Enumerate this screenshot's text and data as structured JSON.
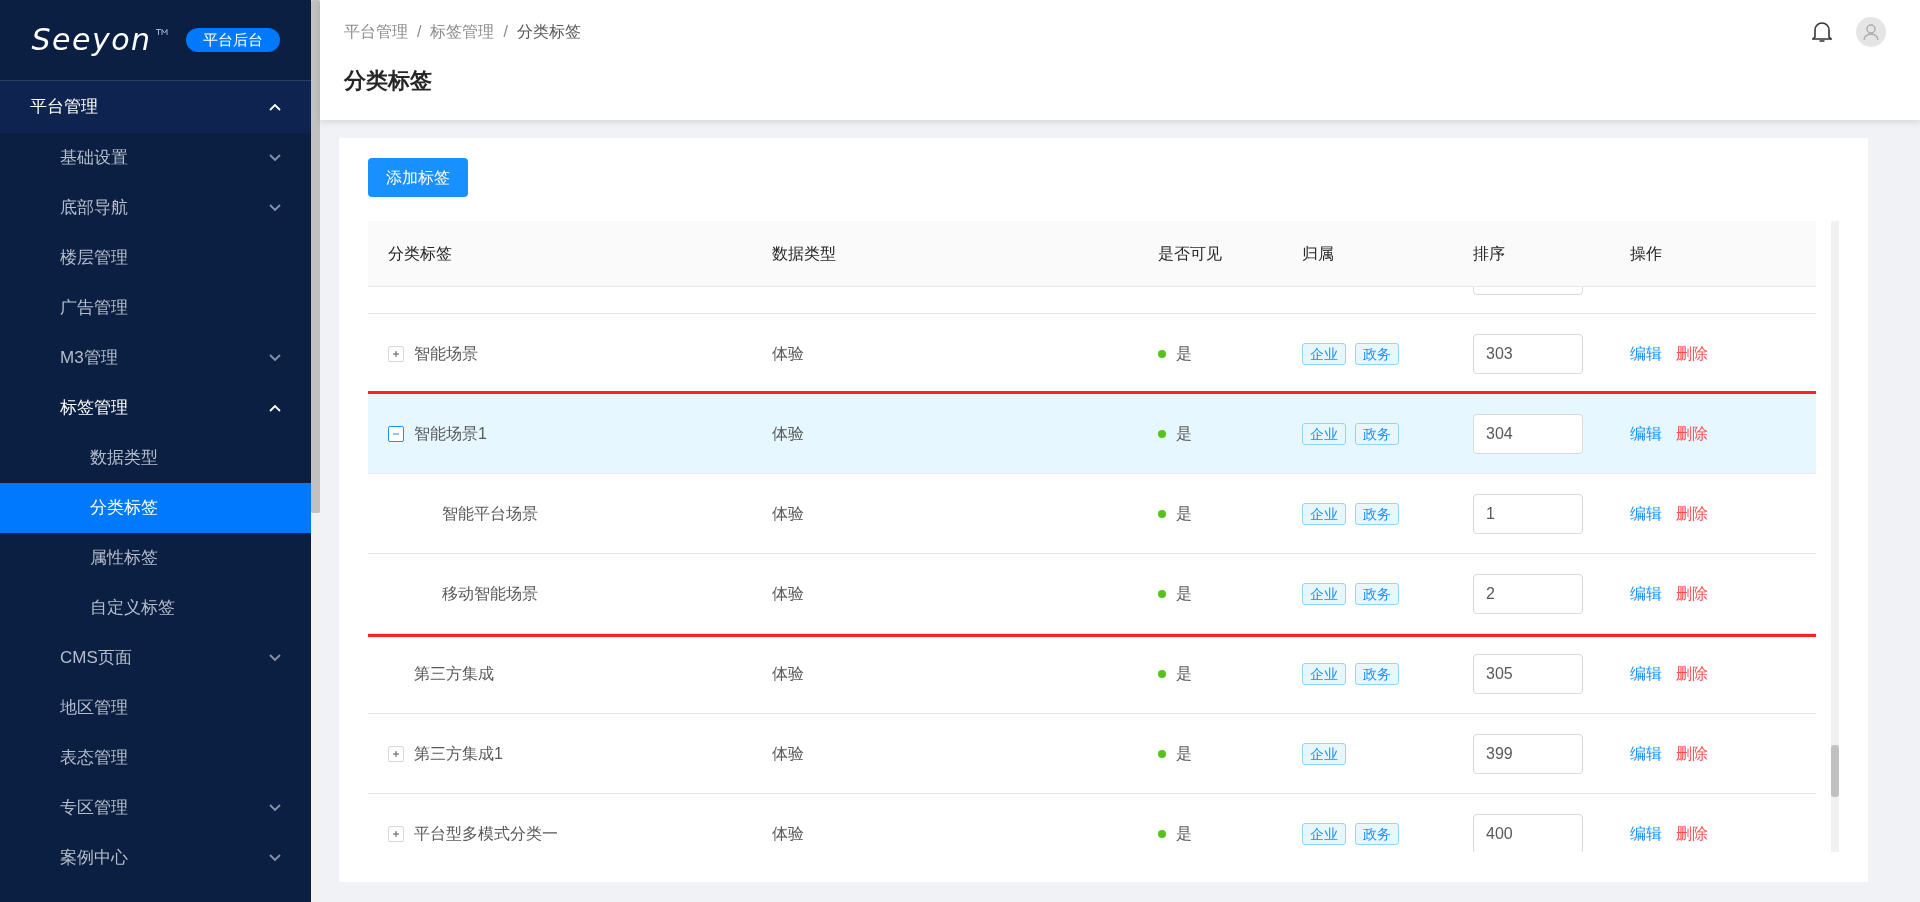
{
  "sidebar": {
    "logo": "Seeyon",
    "badge": "平台后台",
    "items": [
      {
        "label": "平台管理",
        "has_children": true,
        "expanded": true,
        "selected": false,
        "children": [
          {
            "label": "基础设置",
            "has_children": true,
            "expanded": false,
            "selected": false
          },
          {
            "label": "底部导航",
            "has_children": true,
            "expanded": false,
            "selected": false
          },
          {
            "label": "楼层管理",
            "has_children": false,
            "expanded": false,
            "selected": false
          },
          {
            "label": "广告管理",
            "has_children": false,
            "expanded": false,
            "selected": false
          },
          {
            "label": "M3管理",
            "has_children": true,
            "expanded": false,
            "selected": false
          },
          {
            "label": "标签管理",
            "has_children": true,
            "expanded": true,
            "selected": false,
            "children": [
              {
                "label": "数据类型",
                "has_children": false,
                "expanded": false,
                "selected": false
              },
              {
                "label": "分类标签",
                "has_children": false,
                "expanded": false,
                "selected": true
              },
              {
                "label": "属性标签",
                "has_children": false,
                "expanded": false,
                "selected": false
              },
              {
                "label": "自定义标签",
                "has_children": false,
                "expanded": false,
                "selected": false
              }
            ]
          },
          {
            "label": "CMS页面",
            "has_children": true,
            "expanded": false,
            "selected": false
          },
          {
            "label": "地区管理",
            "has_children": false,
            "expanded": false,
            "selected": false
          },
          {
            "label": "表态管理",
            "has_children": false,
            "expanded": false,
            "selected": false
          },
          {
            "label": "专区管理",
            "has_children": true,
            "expanded": false,
            "selected": false
          },
          {
            "label": "案例中心",
            "has_children": true,
            "expanded": false,
            "selected": false
          }
        ]
      }
    ]
  },
  "breadcrumb": [
    "平台管理",
    "标签管理",
    "分类标签"
  ],
  "breadcrumb_separator": "/",
  "page_title": "分类标签",
  "add_button": "添加标签",
  "table": {
    "columns": [
      "分类标签",
      "数据类型",
      "是否可见",
      "归属",
      "排序",
      "操作"
    ],
    "rows": [
      {
        "name": "智能场景",
        "type": "体验",
        "visible": true,
        "visible_label": "是",
        "owners": [
          "企业",
          "政务"
        ],
        "order": "303",
        "actions": [
          "编辑",
          "删除"
        ],
        "expanded": false,
        "selected": false,
        "highlighted": false
      },
      {
        "name": "智能场景1",
        "type": "体验",
        "visible": true,
        "visible_label": "是",
        "owners": [
          "企业",
          "政务"
        ],
        "order": "304",
        "actions": [
          "编辑",
          "删除"
        ],
        "expanded": true,
        "selected": true,
        "highlighted": true,
        "children": [
          {
            "name": "智能平台场景",
            "type": "体验",
            "visible": true,
            "visible_label": "是",
            "owners": [
              "企业",
              "政务"
            ],
            "order": "1",
            "actions": [
              "编辑",
              "删除"
            ],
            "selected": false
          },
          {
            "name": "移动智能场景",
            "type": "体验",
            "visible": true,
            "visible_label": "是",
            "owners": [
              "企业",
              "政务"
            ],
            "order": "2",
            "actions": [
              "编辑",
              "删除"
            ],
            "selected": false
          }
        ]
      },
      {
        "name": "第三方集成",
        "type": "体验",
        "visible": true,
        "visible_label": "是",
        "owners": [
          "企业",
          "政务"
        ],
        "order": "305",
        "actions": [
          "编辑",
          "删除"
        ],
        "selected": false,
        "highlighted": false
      },
      {
        "name": "第三方集成1",
        "type": "体验",
        "visible": true,
        "visible_label": "是",
        "owners": [
          "企业"
        ],
        "order": "399",
        "actions": [
          "编辑",
          "删除"
        ],
        "expanded": false,
        "selected": false,
        "highlighted": false
      },
      {
        "name": "平台型多模式分类一",
        "type": "体验",
        "visible": true,
        "visible_label": "是",
        "owners": [
          "企业",
          "政务"
        ],
        "order": "400",
        "actions": [
          "编辑",
          "删除"
        ],
        "expanded": false,
        "selected": false,
        "highlighted": false
      }
    ]
  }
}
